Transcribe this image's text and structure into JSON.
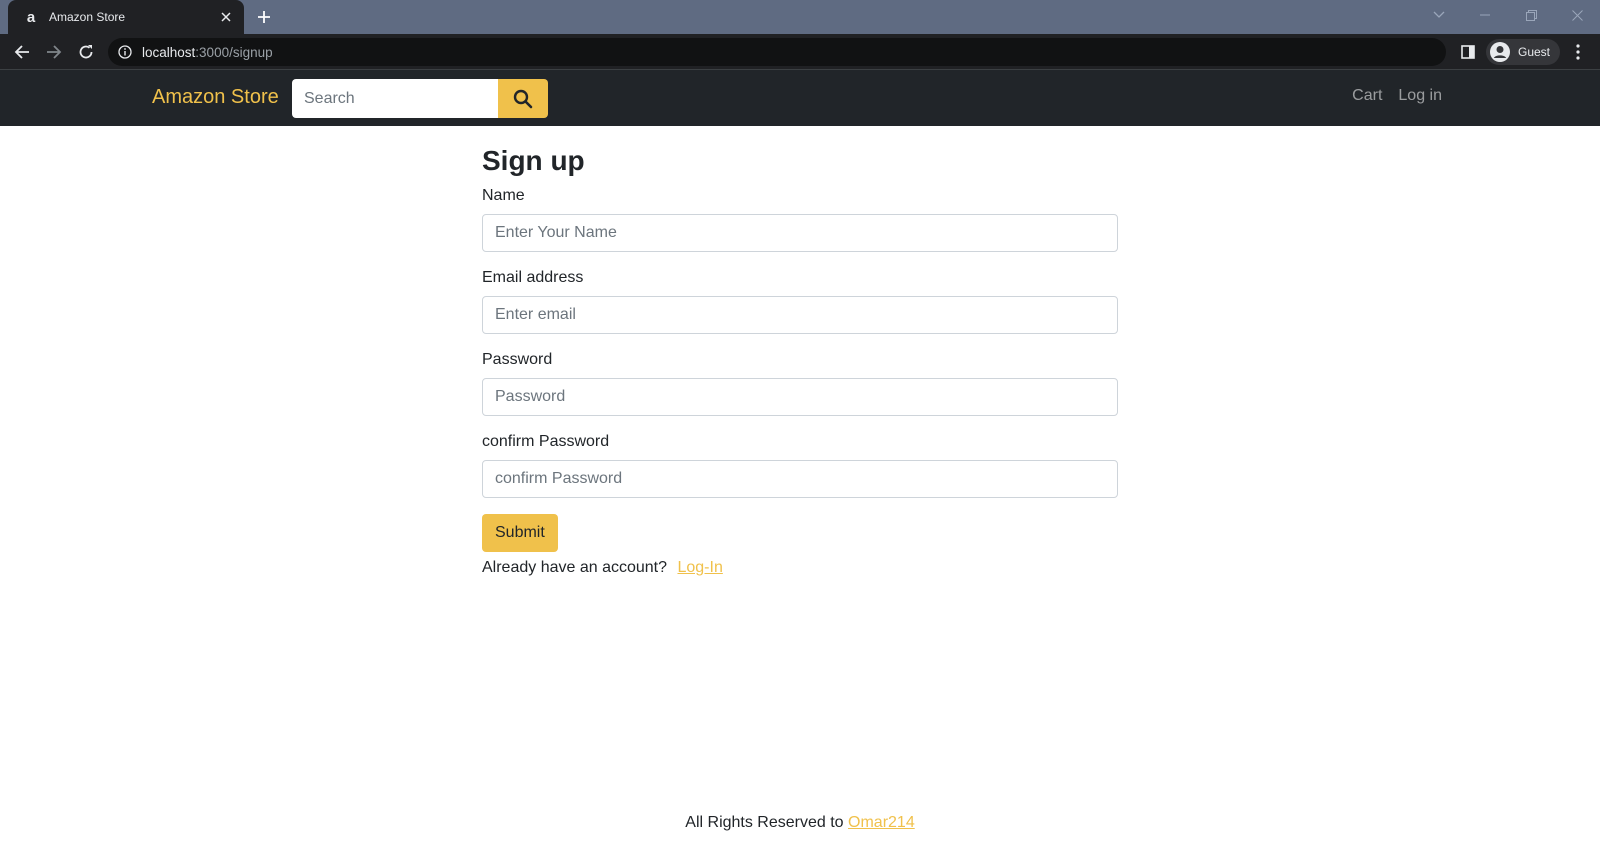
{
  "browser": {
    "tab": {
      "title": "Amazon Store",
      "favicon_icon": "amazon-a-icon"
    },
    "url": {
      "host": "localhost",
      "path": ":3000/signup"
    },
    "profile_label": "Guest"
  },
  "navbar": {
    "brand": "Amazon Store",
    "search": {
      "placeholder": "Search",
      "value": ""
    },
    "links": [
      {
        "label": "Cart"
      },
      {
        "label": "Log in"
      }
    ]
  },
  "form": {
    "title": "Sign up",
    "fields": [
      {
        "label": "Name",
        "placeholder": "Enter Your Name",
        "value": ""
      },
      {
        "label": "Email address",
        "placeholder": "Enter email",
        "value": ""
      },
      {
        "label": "Password",
        "placeholder": "Password",
        "value": ""
      },
      {
        "label": "confirm Password",
        "placeholder": "confirm Password",
        "value": ""
      }
    ],
    "submit_label": "Submit",
    "have_account_text": "Already have an account?",
    "login_link": "Log-In"
  },
  "footer": {
    "text": "All Rights Reserved to ",
    "link": "Omar214"
  },
  "colors": {
    "accent": "#f0c14b",
    "navbar_bg": "#212529",
    "tabstrip_bg": "#5f6b82",
    "chrome_dark": "#202124"
  }
}
